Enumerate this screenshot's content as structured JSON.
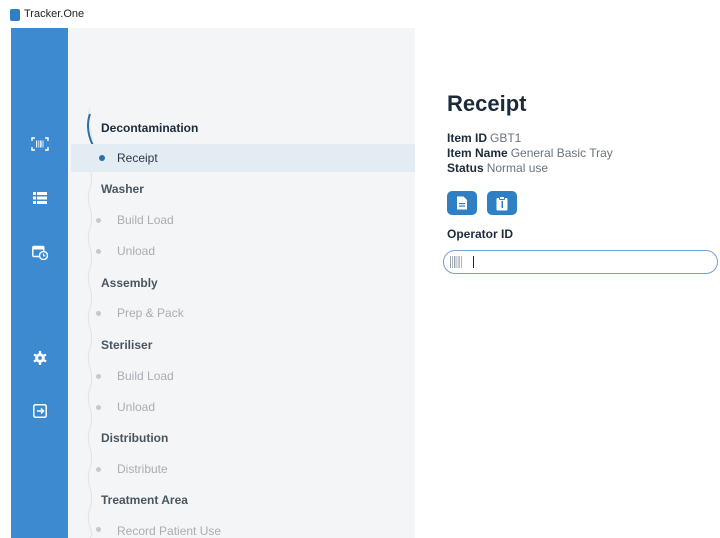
{
  "app": {
    "title": "Tracker.One"
  },
  "nav_rail": [
    {
      "icon": "barcode-scan-icon"
    },
    {
      "icon": "list-icon"
    },
    {
      "icon": "calendar-clock-icon"
    },
    {
      "icon": "gear-icon"
    },
    {
      "icon": "logout-icon"
    }
  ],
  "workflow": {
    "groups": [
      {
        "title": "Decontamination",
        "steps": [
          "Receipt"
        ]
      },
      {
        "title": "Washer",
        "steps": [
          "Build Load",
          "Unload"
        ]
      },
      {
        "title": "Assembly",
        "steps": [
          "Prep & Pack"
        ]
      },
      {
        "title": "Steriliser",
        "steps": [
          "Build Load",
          "Unload"
        ]
      },
      {
        "title": "Distribution",
        "steps": [
          "Distribute"
        ]
      },
      {
        "title": "Treatment Area",
        "steps": [
          "Record Patient Use"
        ]
      }
    ],
    "active_step": "Receipt"
  },
  "detail": {
    "title": "Receipt",
    "item_id_label": "Item ID",
    "item_id": "GBT1",
    "item_name_label": "Item Name",
    "item_name": "General Basic Tray",
    "status_label": "Status",
    "status": "Normal use",
    "buttons": [
      {
        "icon": "document-icon"
      },
      {
        "icon": "clipboard-icon"
      }
    ],
    "operator_label": "Operator ID",
    "operator_value": "",
    "operator_placeholder": ""
  },
  "colors": {
    "accent": "#3d8ad0",
    "button": "#2f7fc4",
    "sidebar_bg": "#f4f5f6",
    "active_step_bg": "#e3ebf3"
  }
}
